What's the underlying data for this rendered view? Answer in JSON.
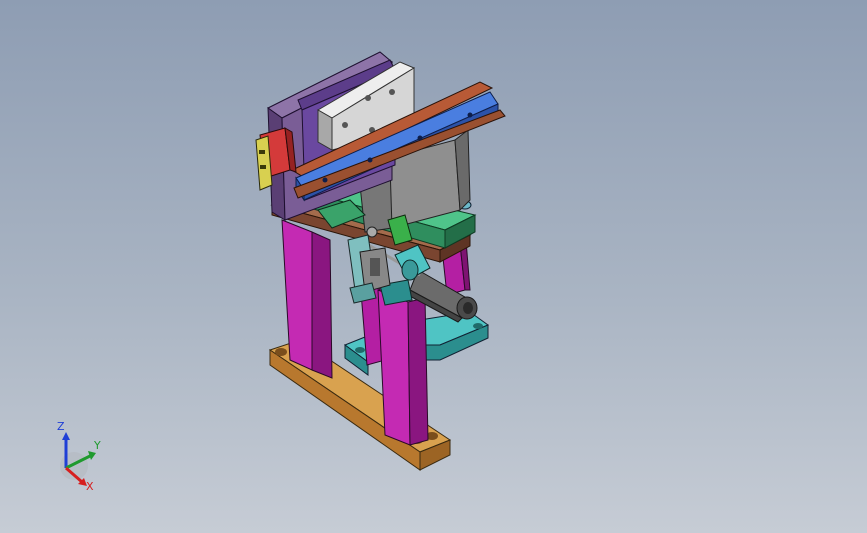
{
  "viewport": {
    "background_top": "#8e9db3",
    "background_bottom": "#c6ccd5"
  },
  "model": {
    "colors": {
      "base_plate": "#c98a3a",
      "columns": "#b41fa3",
      "column_shade": "#7e1372",
      "top_plate": "#8f5a3c",
      "green_block": "#3aa36a",
      "teal_block": "#38a8a8",
      "blue_rail": "#3d6fd0",
      "rail_brown": "#8a4a2e",
      "purple_plate": "#6d4e8a",
      "gray_block": "#8b8b8b",
      "white_slider": "#d9d9d9",
      "cylinder": "#6b6b6b",
      "red_sensor": "#c62828",
      "yellow_sensor": "#c8c23a"
    }
  },
  "triad": {
    "z_label": "Z",
    "y_label": "Y",
    "x_label": "X",
    "z_color": "#1f3fd6",
    "y_color": "#1f9a2e",
    "x_color": "#d61f1f"
  }
}
